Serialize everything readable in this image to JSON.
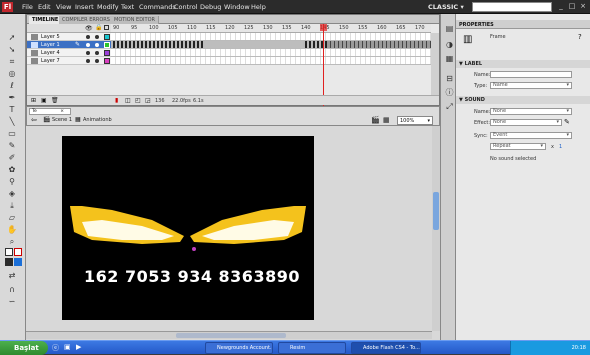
{
  "menu": {
    "logo": "Fl",
    "items": [
      "File",
      "Edit",
      "View",
      "Insert",
      "Modify",
      "Text",
      "Commands",
      "Control",
      "Debug",
      "Window",
      "Help"
    ],
    "workspace": "CLASSIC ▾"
  },
  "timeline": {
    "tabs": [
      "TIMELINE",
      "COMPILER ERRORS",
      "MOTION EDITOR"
    ],
    "ruler": [
      "90",
      "95",
      "100",
      "105",
      "110",
      "115",
      "120",
      "125",
      "130",
      "135",
      "140",
      "145",
      "150",
      "155",
      "160",
      "165",
      "170"
    ],
    "layers": [
      {
        "name": "Layer 5",
        "color": "#19c7d1",
        "selected": false
      },
      {
        "name": "Layer 1",
        "color": "#2bc32b",
        "selected": true
      },
      {
        "name": "Layer 4",
        "color": "#9b3fd8",
        "selected": false
      },
      {
        "name": "Layer 7",
        "color": "#d83fbf",
        "selected": false
      }
    ],
    "footer": {
      "frame": "136",
      "fps": "22.0fps",
      "time": "6.1s"
    }
  },
  "editor": {
    "tab": "Te",
    "breadcrumb": [
      "Scene 1",
      "Animationb"
    ],
    "zoom": "100%"
  },
  "stage": {
    "number_text": "162 7053 934 8363890",
    "eye_color": "#f4c21c",
    "eye_inner": "#fffbe6"
  },
  "properties": {
    "tab": "PROPERTIES",
    "type": "Frame",
    "label_section": "LABEL",
    "name_label": "Name:",
    "type_label": "Type:",
    "type_value": "Name",
    "sound_section": "SOUND",
    "sound_name_label": "Name:",
    "sound_name_value": "None",
    "effect_label": "Effect:",
    "effect_value": "None",
    "sync_label": "Sync:",
    "sync_value": "Event",
    "repeat_value": "Repeat",
    "repeat_x": "x",
    "repeat_count": "1",
    "no_sound": "No sound selected"
  },
  "taskbar": {
    "start": "Başlat",
    "buttons": [
      "Newgrounds Account...",
      "Resim",
      "Adobe Flash CS4 - To..."
    ],
    "clock": "20:18"
  }
}
